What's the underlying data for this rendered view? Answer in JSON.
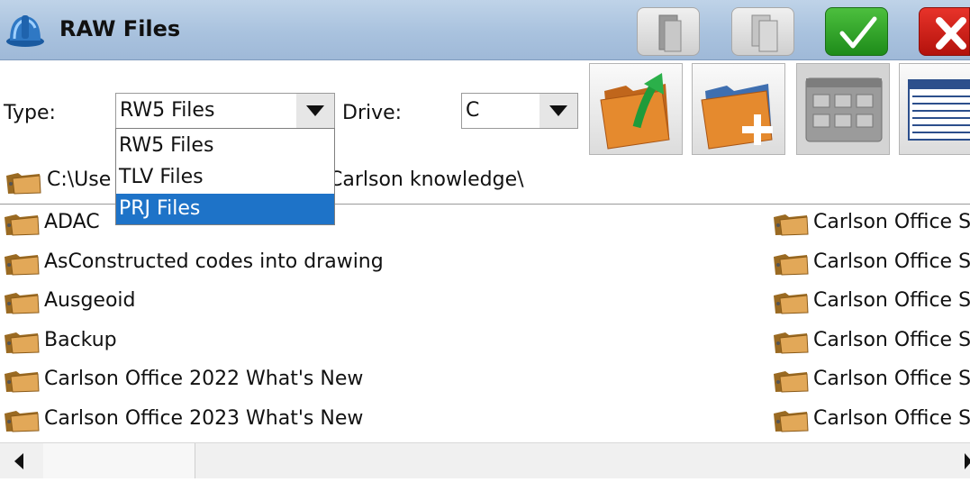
{
  "window": {
    "title": "RAW Files"
  },
  "toolbar": {
    "type_label": "Type:",
    "type_value": "RW5 Files",
    "drive_label": "Drive:",
    "drive_value": "C"
  },
  "type_dropdown": {
    "options": [
      "RW5 Files",
      "TLV Files",
      "PRJ Files"
    ],
    "highlighted": "PRJ Files"
  },
  "path": {
    "segment_visible_left": "C:\\Use",
    "segment_visible_right": "Carlson knowledge\\"
  },
  "folders": {
    "left": [
      "ADAC",
      "AsConstructed codes into drawing",
      "Ausgeoid",
      "Backup",
      "Carlson Office 2022 What's New",
      "Carlson Office 2023 What's New"
    ],
    "right": [
      "Carlson Office S",
      "Carlson Office S",
      "Carlson Office S",
      "Carlson Office S",
      "Carlson Office S",
      "Carlson Office S"
    ]
  },
  "colors": {
    "titlebar": "#a9c2de",
    "selection": "#1e73c8",
    "ok": "#2aa324",
    "cancel": "#d01a12"
  },
  "icons": [
    "hardhat-icon",
    "paste-icon",
    "copy-icon",
    "checkmark-icon",
    "close-icon",
    "folder-up-icon",
    "new-folder-icon",
    "icon-view-icon",
    "list-view-icon",
    "folder-icon"
  ]
}
